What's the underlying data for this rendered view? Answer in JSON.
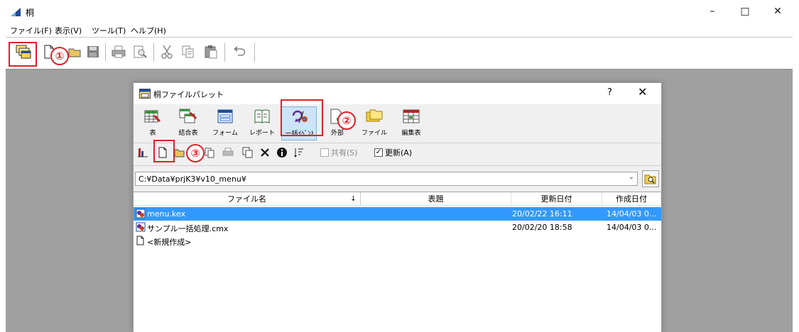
{
  "window": {
    "title": "桐"
  },
  "window_controls": {
    "minimize": "–",
    "maximize": "□",
    "close": "✕"
  },
  "menu": [
    "ファイル(F)",
    "表示(V)",
    "ツール(T)",
    "ヘルプ(H)"
  ],
  "toolbar": {
    "icons": [
      "open-palette-icon",
      "new-file-icon",
      "open-file-icon",
      "save-icon",
      "print-icon",
      "print-preview-icon",
      "cut-icon",
      "copy-icon",
      "paste-icon",
      "undo-icon"
    ]
  },
  "annotations": {
    "one": "①",
    "two": "②",
    "three": "③",
    "accent": "#e0202a"
  },
  "dialog": {
    "title": "桐ファイルパレット",
    "help": "?",
    "close": "✕",
    "categories": [
      "表",
      "結合表",
      "フォーム",
      "レポート",
      "一括ｲﾍﾞﾝﾄ",
      "外部",
      "ファイル",
      "編集表"
    ],
    "checkboxes": {
      "shared": {
        "label": "共有(S)",
        "checked": false
      },
      "update": {
        "label": "更新(A)",
        "checked": true,
        "mark": "✓"
      }
    },
    "path": "C:¥Data¥prjK3¥v10_menu¥",
    "path_arrow": "⌄",
    "columns": {
      "name": "ファイル名",
      "sort": "↓",
      "title": "表題",
      "updated": "更新日付",
      "created": "作成日付"
    },
    "files": [
      {
        "name": "menu.kex",
        "title": "",
        "updated": "20/02/22 16:11",
        "created": "14/04/03 0...",
        "selected": true
      },
      {
        "name": "サンプル一括処理.cmx",
        "title": "",
        "updated": "20/02/20 18:58",
        "created": "14/04/03 0...",
        "selected": false
      },
      {
        "name": "<新規作成>",
        "title": "",
        "updated": "",
        "created": "",
        "selected": false
      }
    ],
    "selection_color": "#3399ff"
  }
}
